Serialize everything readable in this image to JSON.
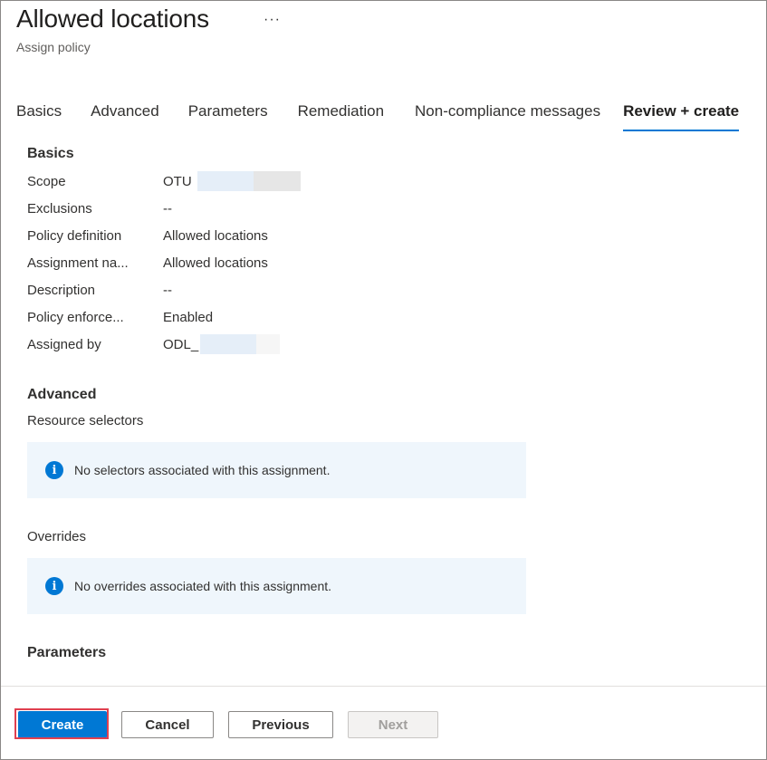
{
  "header": {
    "title": "Allowed locations",
    "subtitle": "Assign policy",
    "more_label": "···"
  },
  "tabs": [
    {
      "label": "Basics",
      "active": false
    },
    {
      "label": "Advanced",
      "active": false
    },
    {
      "label": "Parameters",
      "active": false
    },
    {
      "label": "Remediation",
      "active": false
    },
    {
      "label": "Non-compliance messages",
      "active": false
    },
    {
      "label": "Review + create",
      "active": true
    }
  ],
  "basics": {
    "heading": "Basics",
    "rows": [
      {
        "key": "Scope",
        "value": "OTU"
      },
      {
        "key": "Exclusions",
        "value": "--"
      },
      {
        "key": "Policy definition",
        "value": "Allowed locations"
      },
      {
        "key": "Assignment na...",
        "value": "Allowed locations"
      },
      {
        "key": "Description",
        "value": "--"
      },
      {
        "key": "Policy enforce...",
        "value": "Enabled"
      },
      {
        "key": "Assigned by",
        "value": "ODL_"
      }
    ]
  },
  "advanced": {
    "heading": "Advanced",
    "resource_selectors_label": "Resource selectors",
    "resource_selectors_info": "No selectors associated with this assignment.",
    "overrides_label": "Overrides",
    "overrides_info": "No overrides associated with this assignment."
  },
  "parameters": {
    "heading": "Parameters"
  },
  "footer": {
    "create_label": "Create",
    "cancel_label": "Cancel",
    "previous_label": "Previous",
    "next_label": "Next"
  },
  "colors": {
    "accent": "#0078d4",
    "info_background": "#eff6fc",
    "highlight_border": "#e04050"
  }
}
